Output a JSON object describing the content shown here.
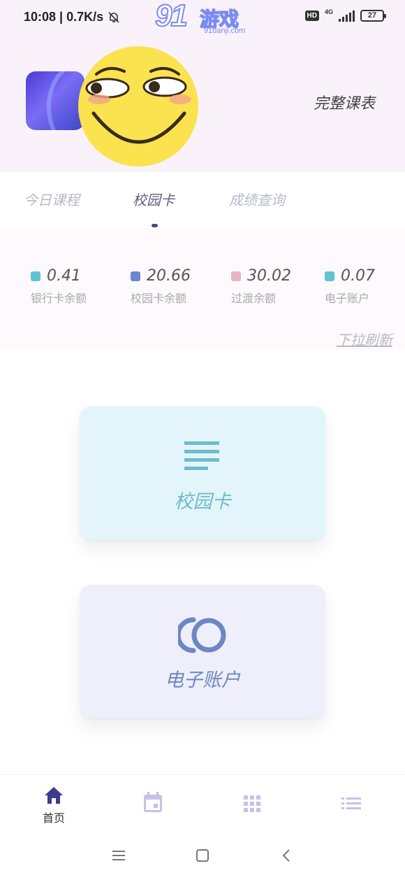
{
  "status_bar": {
    "time_speed": "10:08 | 0.7K/s",
    "hd": "HD",
    "network": "4G",
    "battery": "27"
  },
  "watermark": {
    "number": "91",
    "chinese": "游戏",
    "domain": "91danji.com"
  },
  "header": {
    "full_schedule": "完整课表"
  },
  "tabs": [
    {
      "label": "今日课程",
      "active": false
    },
    {
      "label": "校园卡",
      "active": true
    },
    {
      "label": "成绩查询",
      "active": false
    }
  ],
  "stats": [
    {
      "value": "0.41",
      "label": "银行卡余额",
      "color": "#5ec4d3"
    },
    {
      "value": "20.66",
      "label": "校园卡余额",
      "color": "#6b86d2"
    },
    {
      "value": "30.02",
      "label": "过渡余额",
      "color": "#eab4c3"
    },
    {
      "value": "0.07",
      "label": "电子账户",
      "color": "#5ec4d3"
    }
  ],
  "refresh": "下拉刷新",
  "cards": [
    {
      "label": "校园卡",
      "icon": "lines-icon",
      "color": "#6dbccb"
    },
    {
      "label": "电子账户",
      "icon": "circles-icon",
      "color": "#6f86c4"
    }
  ],
  "bottom_nav": [
    {
      "label": "首页",
      "icon": "home-icon",
      "active": true
    },
    {
      "label": "",
      "icon": "calendar-icon",
      "active": false
    },
    {
      "label": "",
      "icon": "grid-icon",
      "active": false
    },
    {
      "label": "",
      "icon": "list-icon",
      "active": false
    }
  ],
  "colors": {
    "accent": "#3b3c8a",
    "inactive_icon": "#c6c2e6",
    "header_bg": "#f9f2fa"
  }
}
